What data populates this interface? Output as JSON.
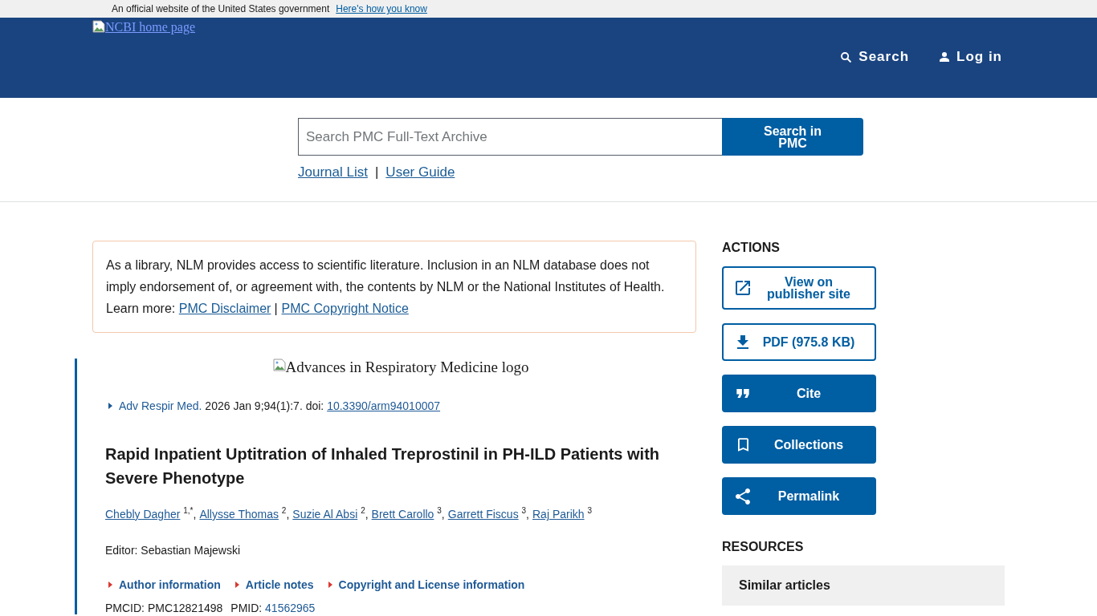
{
  "gov_banner": {
    "text": "An official website of the United States government",
    "link": "Here's how you know"
  },
  "header": {
    "logo_link": "NCBI home page",
    "nav": [
      {
        "label": "Search"
      },
      {
        "label": "Log in"
      }
    ]
  },
  "search": {
    "placeholder": "Search PMC Full-Text Archive",
    "button": "Search in PMC",
    "links": [
      "Journal List",
      "User Guide"
    ],
    "separator": "|"
  },
  "notice": {
    "text": "As a library, NLM provides access to scientific literature. Inclusion in an NLM database does not imply endorsement of, or agreement with, the contents by NLM or the National Institutes of Health. Learn more:",
    "links": [
      "PMC Disclaimer",
      "PMC Copyright Notice"
    ],
    "separator": "|"
  },
  "article": {
    "journal_logo": "Advances in Respiratory Medicine logo",
    "citation": {
      "journal": "Adv Respir Med.",
      "details": "2026 Jan 9;94(1):7. doi:",
      "doi": "10.3390/arm94010007"
    },
    "title": "Rapid Inpatient Uptitration of Inhaled Treprostinil in PH-ILD Patients with Severe Phenotype",
    "authors": [
      {
        "name": "Chebly Dagher",
        "affiliation": "1,*",
        "separator": ","
      },
      {
        "name": "Allysse Thomas",
        "affiliation": "2",
        "separator": ","
      },
      {
        "name": "Suzie Al Absi",
        "affiliation": "2",
        "separator": ","
      },
      {
        "name": "Brett Carollo",
        "affiliation": "3",
        "separator": ","
      },
      {
        "name": "Garrett Fiscus",
        "affiliation": "3",
        "separator": ","
      },
      {
        "name": "Raj Parikh",
        "affiliation": "3"
      }
    ],
    "editor": "Editor: Sebastian Majewski",
    "sections": [
      "Author information",
      "Article notes",
      "Copyright and License information"
    ],
    "ids": {
      "pmcid_label": "PMCID:",
      "pmcid": "PMC12821498",
      "pmid_label": "PMID:",
      "pmid": "41562965"
    }
  },
  "sidebar": {
    "actions_heading": "ACTIONS",
    "actions": [
      {
        "label": "View on publisher site",
        "kind": "outline"
      },
      {
        "label": "PDF (975.8 KB)",
        "kind": "outline"
      },
      {
        "label": "Cite",
        "kind": "filled"
      },
      {
        "label": "Collections",
        "kind": "filled"
      },
      {
        "label": "Permalink",
        "kind": "filled"
      }
    ],
    "resources_heading": "RESOURCES",
    "resources": [
      "Similar articles"
    ]
  }
}
